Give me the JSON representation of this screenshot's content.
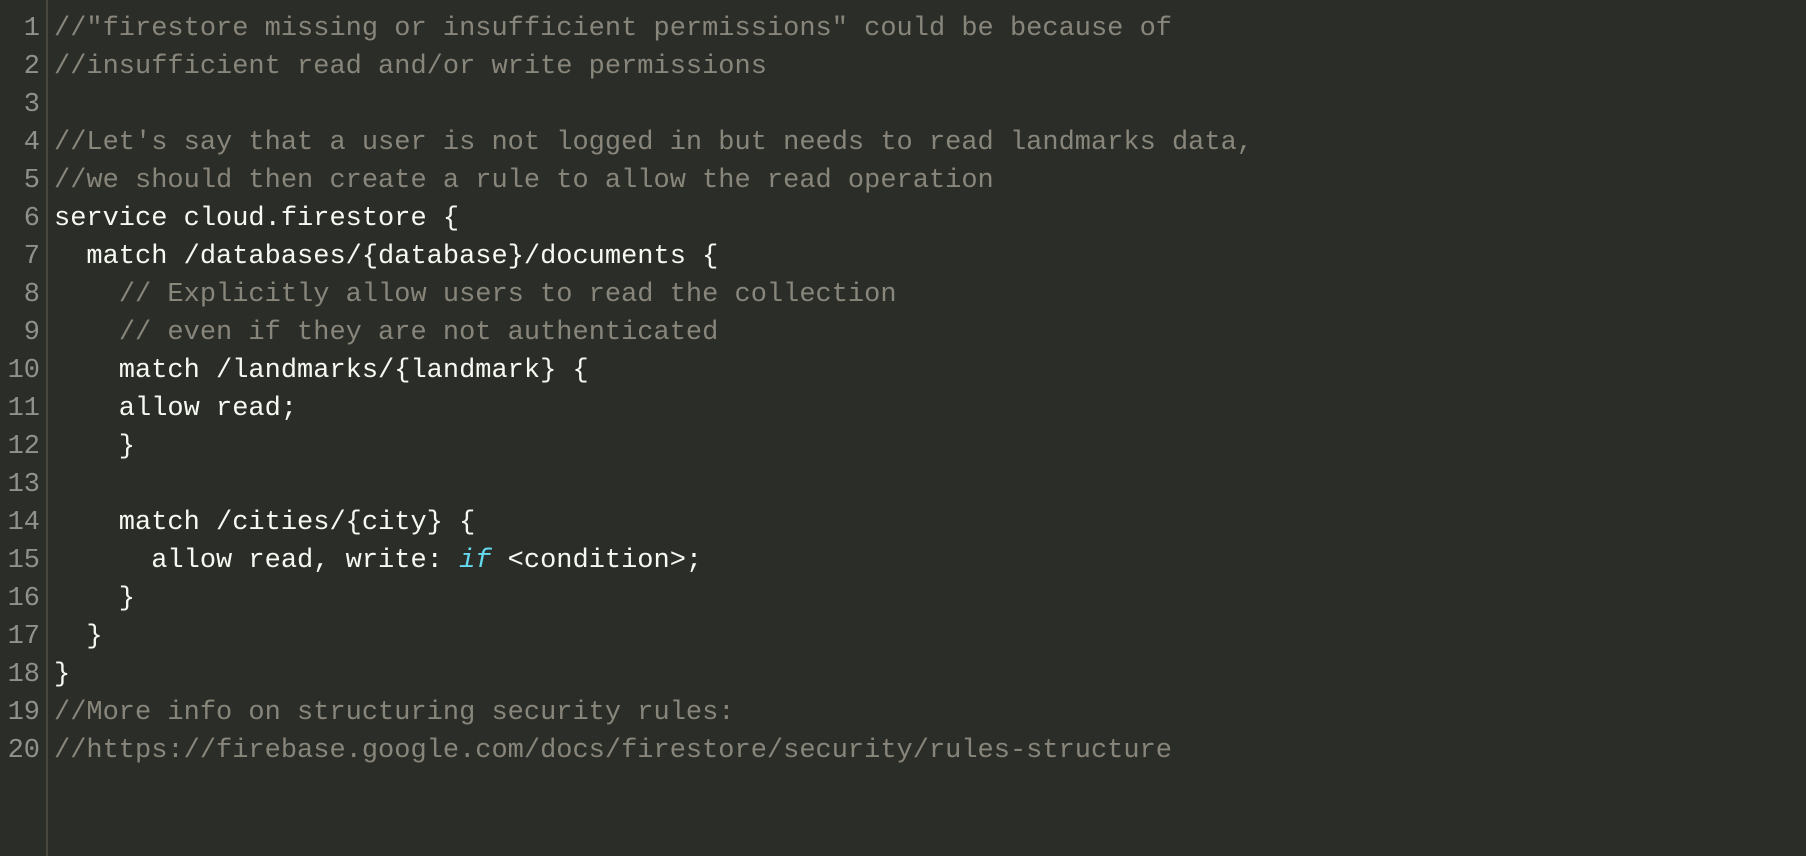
{
  "lineCount": 20,
  "lines": [
    {
      "tokens": [
        {
          "cls": "comment",
          "text": "//\"firestore missing or insufficient permissions\" could be because of "
        }
      ]
    },
    {
      "tokens": [
        {
          "cls": "comment",
          "text": "//insufficient read and/or write permissions"
        }
      ]
    },
    {
      "tokens": []
    },
    {
      "tokens": [
        {
          "cls": "comment",
          "text": "//Let's say that a user is not logged in but needs to read landmarks data, "
        }
      ]
    },
    {
      "tokens": [
        {
          "cls": "comment",
          "text": "//we should then create a rule to allow the read operation"
        }
      ]
    },
    {
      "tokens": [
        {
          "cls": "plain",
          "text": "service cloud.firestore {"
        }
      ]
    },
    {
      "tokens": [
        {
          "cls": "plain",
          "text": "  match /databases/{database}/documents {"
        }
      ]
    },
    {
      "tokens": [
        {
          "cls": "plain",
          "text": "    "
        },
        {
          "cls": "comment",
          "text": "// Explicitly allow users to read the collection"
        }
      ]
    },
    {
      "tokens": [
        {
          "cls": "plain",
          "text": "    "
        },
        {
          "cls": "comment",
          "text": "// even if they are not authenticated"
        }
      ]
    },
    {
      "tokens": [
        {
          "cls": "plain",
          "text": "    match /landmarks/{landmark} {"
        }
      ]
    },
    {
      "tokens": [
        {
          "cls": "plain",
          "text": "    allow read;"
        }
      ]
    },
    {
      "tokens": [
        {
          "cls": "plain",
          "text": "    }    "
        }
      ]
    },
    {
      "tokens": []
    },
    {
      "tokens": [
        {
          "cls": "plain",
          "text": "    match /cities/{city} {"
        }
      ]
    },
    {
      "tokens": [
        {
          "cls": "plain",
          "text": "      allow read, write: "
        },
        {
          "cls": "kwblue",
          "text": "if"
        },
        {
          "cls": "plain",
          "text": " <condition>;"
        }
      ]
    },
    {
      "tokens": [
        {
          "cls": "plain",
          "text": "    }"
        }
      ]
    },
    {
      "tokens": [
        {
          "cls": "plain",
          "text": "  }"
        }
      ]
    },
    {
      "tokens": [
        {
          "cls": "plain",
          "text": "}"
        }
      ]
    },
    {
      "tokens": [
        {
          "cls": "comment",
          "text": "//More info on structuring security rules: "
        }
      ]
    },
    {
      "tokens": [
        {
          "cls": "comment",
          "text": "//https://firebase.google.com/docs/firestore/security/rules-structure"
        }
      ]
    }
  ]
}
